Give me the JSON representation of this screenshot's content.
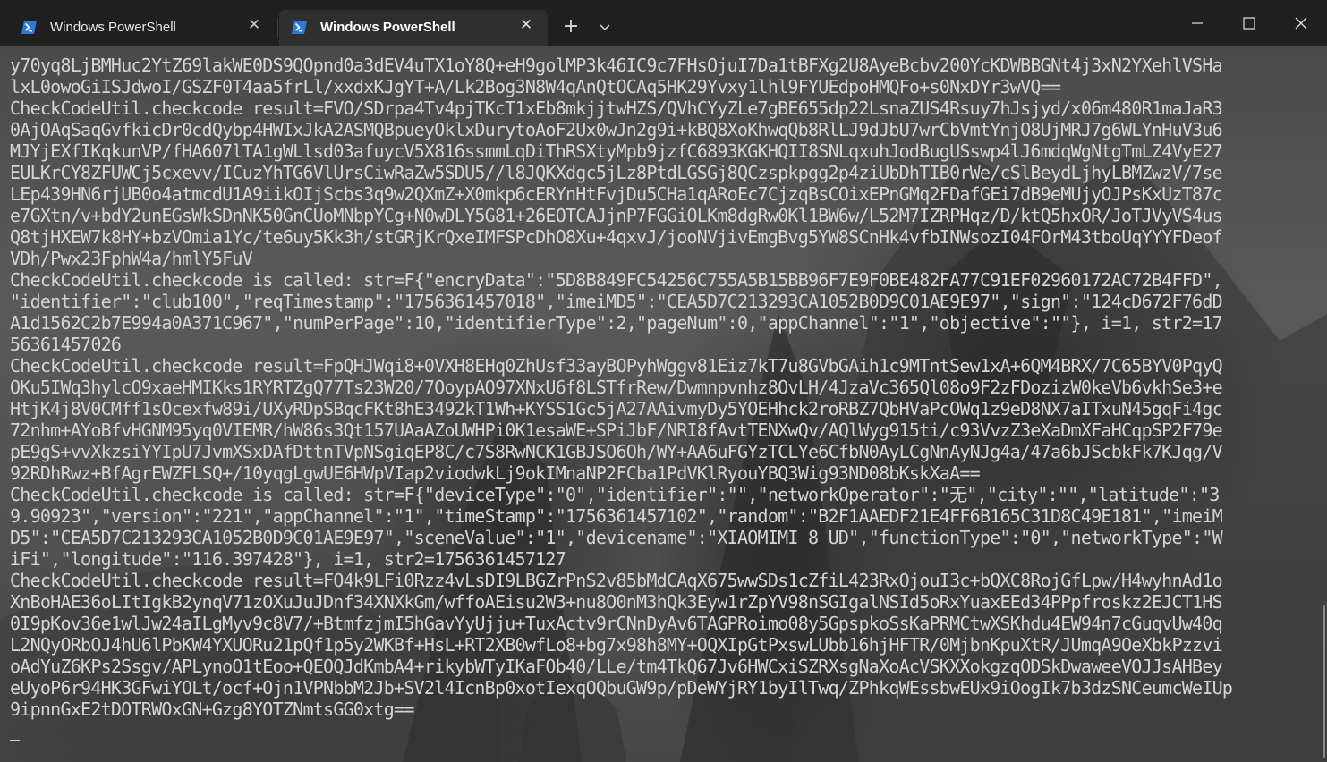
{
  "window": {
    "tabs": [
      {
        "title": "Windows PowerShell",
        "active": false,
        "icon": "powershell-icon"
      },
      {
        "title": "Windows PowerShell",
        "active": true,
        "icon": "powershell-icon"
      }
    ],
    "new_tab_label": "+",
    "close_glyph": "✕",
    "colors": {
      "titlebar": "#202020",
      "active_tab": "#2f2f2f",
      "terminal_text": "#d4d4d4",
      "powershell_icon": "#2d7bd6"
    }
  },
  "terminal": {
    "lines": [
      "y70yq8LjBMHuc2YtZ69lakWE0DS9QOpnd0a3dEV4uTX1oY8Q+eH9golMP3k46IC9c7FHsOjuI7Da1tBFXg2U8AyeBcbv200YcKDWBBGNt4j3xN2YXehlVSHa",
      "lxL0owoGiISJdwoI/GSZF0T4aa5frLl/xxdxKJgYT+A/Lk2Bog3N8W4qAnQtOCAq5HK29Yvxy1lhl9FYUEdpoHMQFo+s0NxDYr3wVQ==",
      "CheckCodeUtil.checkcode result=FVO/SDrpa4Tv4pjTKcT1xEb8mkjjtwHZS/QVhCYyZLe7gBE655dp22LsnaZUS4Rsuy7hJsjyd/x06m480R1maJaR3",
      "0AjOAqSaqGvfkicDr0cdQybp4HWIxJkA2ASMQBpueyOklxDurytoAoF2Ux0wJn2g9i+kBQ8XoKhwqQb8RlLJ9dJbU7wrCbVmtYnjO8UjMRJ7g6WLYnHuV3u6",
      "MJYjEXfIKqkunVP/fHA607lTA1gWLlsd03afuycV5X816ssmmLqDiThRSXtyMpb9jzfC6893KGKHQII8SNLqxuhJodBugUSswp4lJ6mdqWgNtgTmLZ4VyE27",
      "EULKrCY8ZFUWCj5cxevv/ICuzYhTG6VlUrsCiwRaZw5SDU5//l8JQKXdgc5jLz8PtdLGSGj8QCzspkpgg2p4ziUbDhTIB0rWe/cSlBeydLjhyLBMZwzV/7se",
      "LEp439HN6rjUB0o4atmcdU1A9iikOIjScbs3q9w2QXmZ+X0mkp6cERYnHtFvjDu5CHa1qARoEc7CjzqBsCOixEPnGMq2FDafGEi7dB9eMUjyOJPsKxUzT87c",
      "e7GXtn/v+bdY2unEGsWkSDnNK50GnCUoMNbpYCg+N0wDLY5G81+26EOTCAJjnP7FGGiOLKm8dgRw0Kl1BW6w/L52M7IZRPHqz/D/ktQ5hxOR/JoTJVyVS4us",
      "Q8tjHXEW7k8HY+bzVOmia1Yc/te6uy5Kk3h/stGRjKrQxeIMFSPcDhO8Xu+4qxvJ/jooNVjivEmgBvg5YW8SCnHk4vfbINWsozI04FOrM43tboUqYYYFDeof",
      "VDh/Pwx23FphW4a/hmlY5FuV",
      "CheckCodeUtil.checkcode is called: str=F{\"encryData\":\"5D8B849FC54256C755A5B15BB96F7E9F0BE482FA77C91EF02960172AC72B4FFD\",",
      "\"identifier\":\"club100\",\"reqTimestamp\":\"1756361457018\",\"imeiMD5\":\"CEA5D7C213293CA1052B0D9C01AE9E97\",\"sign\":\"124cD672F76dD",
      "A1d1562C2b7E994a0A371C967\",\"numPerPage\":10,\"identifierType\":2,\"pageNum\":0,\"appChannel\":\"1\",\"objective\":\"\"}, i=1, str2=17",
      "56361457026",
      "CheckCodeUtil.checkcode result=FpQHJWqi8+0VXH8EHq0ZhUsf33ayBOPyhWggv81Eiz7kT7u8GVbGAih1c9MTntSew1xA+6QM4BRX/7C65BYV0PqyQ",
      "OKu5IWq3hylcO9xaeHMIKks1RYRTZgQ77Ts23W20/7OoypAO97XNxU6f8LSTfrRew/Dwmnpvnhz8OvLH/4JzaVc365Ql08o9F2zFDozizW0keVb6vkhSe3+e",
      "HtjK4j8V0CMff1sOcexfw89i/UXyRDpSBqcFKt8hE3492kT1Wh+KYSS1Gc5jA27AAivmyDy5YOEHhck2roRBZ7QbHVaPcOWq1z9eD8NX7aITxuN45gqFi4gc",
      "72nhm+AYoBfvHGNM95yq0VIEMR/hW86s3Qt157UAaAZoUWHPi0K1esaWE+SPiJbF/NRI8fAvtTENXwQv/AQlWyg915ti/c93VvzZ3eXaDmXFaHCqpSP2F79e",
      "pE9gS+vvXkzsiYYIpU7JvmXSxDAfDttnTVpNSgiqEP8C/c7S8RwNCK1GBJSO6Oh/WY+AA6uFGYzTCLYe6CfbN0AyLCgNnAyNJg4a/47a6bJScbkFk7KJqg/V",
      "92RDhRwz+BfAgrEWZFLSQ+/10yqgLgwUE6HWpVIap2viodwkLj9okIMnaNP2FCba1PdVKlRyouYBQ3Wig93ND08bKskXaA==",
      "CheckCodeUtil.checkcode is called: str=F{\"deviceType\":\"0\",\"identifier\":\"\",\"networkOperator\":\"无\",\"city\":\"\",\"latitude\":\"3",
      "9.90923\",\"version\":\"221\",\"appChannel\":\"1\",\"timeStamp\":\"1756361457102\",\"random\":\"B2F1AAEDF21E4FF6B165C31D8C49E181\",\"imeiM",
      "D5\":\"CEA5D7C213293CA1052B0D9C01AE9E97\",\"sceneValue\":\"1\",\"devicename\":\"XIAOMIMI 8 UD\",\"functionType\":\"0\",\"networkType\":\"W",
      "iFi\",\"longitude\":\"116.397428\"}, i=1, str2=1756361457127",
      "CheckCodeUtil.checkcode result=FO4k9LFi0Rzz4vLsDI9LBGZrPnS2v85bMdCAqX675wwSDs1cZfiL423RxOjouI3c+bQXC8RojGfLpw/H4wyhnAd1o",
      "XnBoHAE36oLItIgkB2ynqV71zOXuJuJDnf34XNXkGm/wffoAEisu2W3+nu8O0nM3hQk3Eyw1rZpYV98nSGIgalNSId5oRxYuaxEEd34PPpfroskz2EJCT1HS",
      "0I9pKov36e1wlJw24aILgMyv9c8V7/+BtmfzjmI5hGavYyUjju+TuxActv9rCNnDyAv6TAGPRoimo08y5GpspkoSsKaPRMCtwXSKhdu4EW94n7cGuqvUw40q",
      "L2NQyORbOJ4hU6lPbKW4YXUORu21pQf1p5y2WKBf+HsL+RT2XB0wfLo8+bg7x98h8MY+OQXIpGtPxswLUbb16hjHFTR/0MjbnKpuXtR/JUmqA9OeXbkPzzvi",
      "oAdYuZ6KPs2Ssgv/APLynoO1tEoo+QEOQJdKmbA4+rikybWTyIKaFOb40/LLe/tm4TkQ67Jv6HWCxiSZRXsgNaXoAcVSKXXokgzqODSkDwaweeVOJJsAHBey",
      "eUyoP6r94HK3GFwiYOLt/ocf+Ojn1VPNbbM2Jb+SV2l4IcnBp0xotIexqOQbuGW9p/pDeWYjRY1byIlTwq/ZPhkqWEssbwEUx9iOogIk7b3dzSNCeumcWeIUp",
      "9ipnnGxE2tDOTRWOxGN+Gzg8YOTZNmtsGG0xtg=="
    ],
    "prompt_cursor": "_"
  }
}
